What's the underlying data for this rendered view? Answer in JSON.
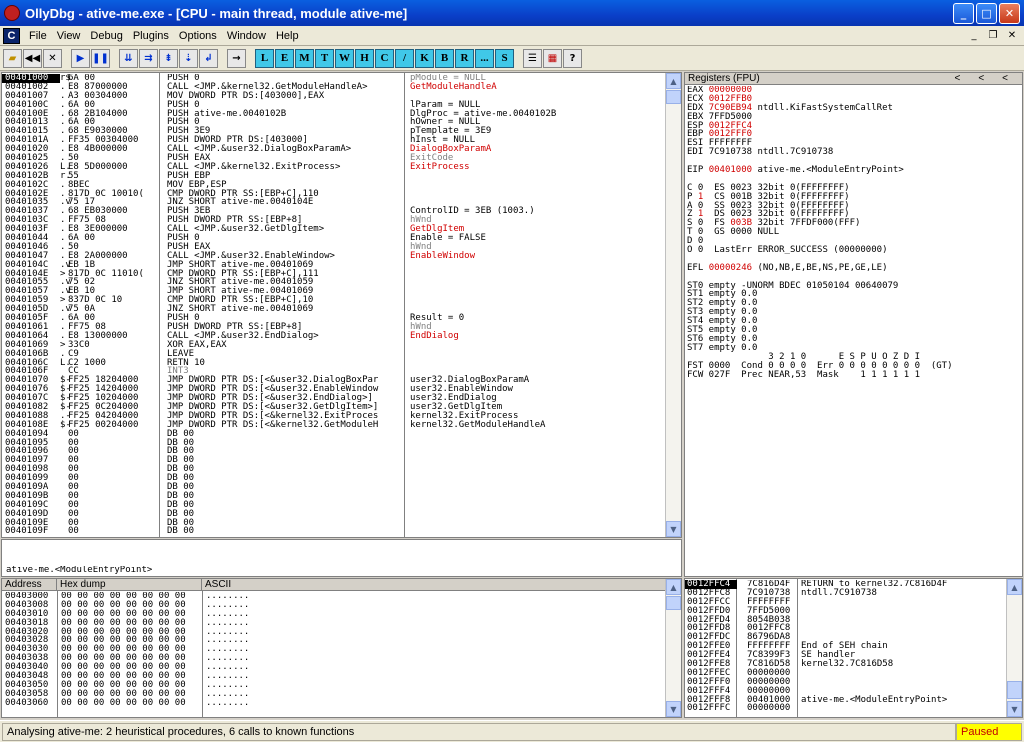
{
  "window": {
    "title": "OllyDbg - ative-me.exe - [CPU - main thread, module ative-me]"
  },
  "menu": {
    "child_icon": "C",
    "items": [
      "File",
      "View",
      "Debug",
      "Plugins",
      "Options",
      "Window",
      "Help"
    ]
  },
  "toolbar": {
    "letters": [
      "L",
      "E",
      "M",
      "T",
      "W",
      "H",
      "C",
      "/",
      "K",
      "B",
      "R",
      "...",
      "S"
    ]
  },
  "disasm": {
    "rows": [
      {
        "a": "00401000",
        "m": "r$",
        "h": "6A 00",
        "d": "PUSH 0",
        "c": "pModule = NULL",
        "cc": "gray"
      },
      {
        "a": "00401002",
        "m": ".",
        "h": "E8 87000000",
        "d": "CALL <JMP.&kernel32.GetModuleHandleA>",
        "c": "GetModuleHandleA",
        "cc": "red"
      },
      {
        "a": "00401007",
        "m": ".",
        "h": "A3 00304000",
        "d": "MOV DWORD PTR DS:[403000],EAX",
        "c": "",
        "cc": ""
      },
      {
        "a": "0040100C",
        "m": ".",
        "h": "6A 00",
        "d": "PUSH 0",
        "c": "lParam = NULL",
        "cc": ""
      },
      {
        "a": "0040100E",
        "m": ".",
        "h": "68 2B104000",
        "d": "PUSH ative-me.0040102B",
        "c": "DlgProc = ative-me.0040102B",
        "cc": ""
      },
      {
        "a": "00401013",
        "m": ".",
        "h": "6A 00",
        "d": "PUSH 0",
        "c": "hOwner = NULL",
        "cc": ""
      },
      {
        "a": "00401015",
        "m": ".",
        "h": "68 E9030000",
        "d": "PUSH 3E9",
        "c": "pTemplate = 3E9",
        "cc": ""
      },
      {
        "a": "0040101A",
        "m": ".",
        "h": "FF35 00304000",
        "d": "PUSH DWORD PTR DS:[403000]",
        "c": "hInst = NULL",
        "cc": ""
      },
      {
        "a": "00401020",
        "m": ".",
        "h": "E8 4B000000",
        "d": "CALL <JMP.&user32.DialogBoxParamA>",
        "c": "DialogBoxParamA",
        "cc": "red"
      },
      {
        "a": "00401025",
        "m": ".",
        "h": "50",
        "d": "PUSH EAX",
        "c": "ExitCode",
        "cc": "gray"
      },
      {
        "a": "00401026",
        "m": "L.",
        "h": "E8 5D000000",
        "d": "CALL <JMP.&kernel32.ExitProcess>",
        "c": "ExitProcess",
        "cc": "red"
      },
      {
        "a": "0040102B",
        "m": "r.",
        "h": "55",
        "d": "PUSH EBP",
        "c": "",
        "cc": ""
      },
      {
        "a": "0040102C",
        "m": ".",
        "h": "8BEC",
        "d": "MOV EBP,ESP",
        "c": "",
        "cc": ""
      },
      {
        "a": "0040102E",
        "m": ".",
        "h": "817D 0C 10010(",
        "d": "CMP DWORD PTR SS:[EBP+C],110",
        "c": "",
        "cc": ""
      },
      {
        "a": "00401035",
        "m": ".v",
        "h": "75 17",
        "d": "JNZ SHORT ative-me.0040104E",
        "c": "",
        "cc": ""
      },
      {
        "a": "00401037",
        "m": ".",
        "h": "68 EB030000",
        "d": "PUSH 3EB",
        "c": "ControlID = 3EB (1003.)",
        "cc": ""
      },
      {
        "a": "0040103C",
        "m": ".",
        "h": "FF75 08",
        "d": "PUSH DWORD PTR SS:[EBP+8]",
        "c": "hWnd",
        "cc": "gray"
      },
      {
        "a": "0040103F",
        "m": ".",
        "h": "E8 3E000000",
        "d": "CALL <JMP.&user32.GetDlgItem>",
        "c": "GetDlgItem",
        "cc": "red"
      },
      {
        "a": "00401044",
        "m": ".",
        "h": "6A 00",
        "d": "PUSH 0",
        "c": "Enable = FALSE",
        "cc": ""
      },
      {
        "a": "00401046",
        "m": ".",
        "h": "50",
        "d": "PUSH EAX",
        "c": "hWnd",
        "cc": "gray"
      },
      {
        "a": "00401047",
        "m": ".",
        "h": "E8 2A000000",
        "d": "CALL <JMP.&user32.EnableWindow>",
        "c": "EnableWindow",
        "cc": "red"
      },
      {
        "a": "0040104C",
        "m": ".v",
        "h": "EB 1B",
        "d": "JMP SHORT ative-me.00401069",
        "c": "",
        "cc": ""
      },
      {
        "a": "0040104E",
        "m": ">",
        "h": "817D 0C 11010(",
        "d": "CMP DWORD PTR SS:[EBP+C],111",
        "c": "",
        "cc": ""
      },
      {
        "a": "00401055",
        "m": ".v",
        "h": "75 02",
        "d": "JNZ SHORT ative-me.00401059",
        "c": "",
        "cc": ""
      },
      {
        "a": "00401057",
        "m": ".v",
        "h": "EB 10",
        "d": "JMP SHORT ative-me.00401069",
        "c": "",
        "cc": ""
      },
      {
        "a": "00401059",
        "m": ">",
        "h": "837D 0C 10",
        "d": "CMP DWORD PTR SS:[EBP+C],10",
        "c": "",
        "cc": ""
      },
      {
        "a": "0040105D",
        "m": ".v",
        "h": "75 0A",
        "d": "JNZ SHORT ative-me.00401069",
        "c": "",
        "cc": ""
      },
      {
        "a": "0040105F",
        "m": ".",
        "h": "6A 00",
        "d": "PUSH 0",
        "c": "Result = 0",
        "cc": ""
      },
      {
        "a": "00401061",
        "m": ".",
        "h": "FF75 08",
        "d": "PUSH DWORD PTR SS:[EBP+8]",
        "c": "hWnd",
        "cc": "gray"
      },
      {
        "a": "00401064",
        "m": ".",
        "h": "E8 13000000",
        "d": "CALL <JMP.&user32.EndDialog>",
        "c": "EndDialog",
        "cc": "red"
      },
      {
        "a": "00401069",
        "m": ">",
        "h": "33C0",
        "d": "XOR EAX,EAX",
        "c": "",
        "cc": ""
      },
      {
        "a": "0040106B",
        "m": ".",
        "h": "C9",
        "d": "LEAVE",
        "c": "",
        "cc": ""
      },
      {
        "a": "0040106C",
        "m": "L.",
        "h": "C2 1000",
        "d": "RETN 10",
        "c": "",
        "cc": ""
      },
      {
        "a": "0040106F",
        "m": "",
        "h": "CC",
        "d": "INT3",
        "c": "",
        "cc": ""
      },
      {
        "a": "00401070",
        "m": "$-",
        "h": "FF25 18204000",
        "d": "JMP DWORD PTR DS:[<&user32.DialogBoxPar",
        "c": "user32.DialogBoxParamA",
        "cc": ""
      },
      {
        "a": "00401076",
        "m": "$-",
        "h": "FF25 14204000",
        "d": "JMP DWORD PTR DS:[<&user32.EnableWindow",
        "c": "user32.EnableWindow",
        "cc": ""
      },
      {
        "a": "0040107C",
        "m": "$-",
        "h": "FF25 10204000",
        "d": "JMP DWORD PTR DS:[<&user32.EndDialog>]",
        "c": "user32.EndDialog",
        "cc": ""
      },
      {
        "a": "00401082",
        "m": "$-",
        "h": "FF25 0C204000",
        "d": "JMP DWORD PTR DS:[<&user32.GetDlgItem>]",
        "c": "user32.GetDlgItem",
        "cc": ""
      },
      {
        "a": "00401088",
        "m": ".-",
        "h": "FF25 04204000",
        "d": "JMP DWORD PTR DS:[<&kernel32.ExitProces",
        "c": "kernel32.ExitProcess",
        "cc": ""
      },
      {
        "a": "0040108E",
        "m": "$-",
        "h": "FF25 00204000",
        "d": "JMP DWORD PTR DS:[<&kernel32.GetModuleH",
        "c": "kernel32.GetModuleHandleA",
        "cc": ""
      },
      {
        "a": "00401094",
        "m": "",
        "h": "00",
        "d": "DB 00",
        "c": "",
        "cc": ""
      },
      {
        "a": "00401095",
        "m": "",
        "h": "00",
        "d": "DB 00",
        "c": "",
        "cc": ""
      },
      {
        "a": "00401096",
        "m": "",
        "h": "00",
        "d": "DB 00",
        "c": "",
        "cc": ""
      },
      {
        "a": "00401097",
        "m": "",
        "h": "00",
        "d": "DB 00",
        "c": "",
        "cc": ""
      },
      {
        "a": "00401098",
        "m": "",
        "h": "00",
        "d": "DB 00",
        "c": "",
        "cc": ""
      },
      {
        "a": "00401099",
        "m": "",
        "h": "00",
        "d": "DB 00",
        "c": "",
        "cc": ""
      },
      {
        "a": "0040109A",
        "m": "",
        "h": "00",
        "d": "DB 00",
        "c": "",
        "cc": ""
      },
      {
        "a": "0040109B",
        "m": "",
        "h": "00",
        "d": "DB 00",
        "c": "",
        "cc": ""
      },
      {
        "a": "0040109C",
        "m": "",
        "h": "00",
        "d": "DB 00",
        "c": "",
        "cc": ""
      },
      {
        "a": "0040109D",
        "m": "",
        "h": "00",
        "d": "DB 00",
        "c": "",
        "cc": ""
      },
      {
        "a": "0040109E",
        "m": "",
        "h": "00",
        "d": "DB 00",
        "c": "",
        "cc": ""
      },
      {
        "a": "0040109F",
        "m": "",
        "h": "00",
        "d": "DB 00",
        "c": "",
        "cc": ""
      }
    ]
  },
  "info": {
    "text": "ative-me.<ModuleEntryPoint>"
  },
  "registers": {
    "title": "Registers (FPU)",
    "lines": [
      {
        "t": "EAX ",
        "v": "00000000",
        "r": "",
        "vc": "red"
      },
      {
        "t": "ECX ",
        "v": "0012FFB0",
        "r": "",
        "vc": "red"
      },
      {
        "t": "EDX ",
        "v": "7C90EB94",
        "r": " ntdll.KiFastSystemCallRet",
        "vc": "red"
      },
      {
        "t": "EBX ",
        "v": "7FFD5000",
        "r": "",
        "vc": ""
      },
      {
        "t": "ESP ",
        "v": "0012FFC4",
        "r": "",
        "vc": "red"
      },
      {
        "t": "EBP ",
        "v": "0012FFF0",
        "r": "",
        "vc": "red"
      },
      {
        "t": "ESI ",
        "v": "FFFFFFFF",
        "r": "",
        "vc": ""
      },
      {
        "t": "EDI ",
        "v": "7C910738",
        "r": " ntdll.7C910738",
        "vc": ""
      },
      {
        "t": "",
        "v": "",
        "r": "",
        "vc": ""
      },
      {
        "t": "EIP ",
        "v": "00401000",
        "r": " ative-me.<ModuleEntryPoint>",
        "vc": "red"
      },
      {
        "t": "",
        "v": "",
        "r": "",
        "vc": ""
      },
      {
        "t": "C 0  ES 0023 32bit 0(FFFFFFFF)",
        "v": "",
        "r": "",
        "vc": ""
      },
      {
        "t": "P ",
        "v": "1",
        "r": "  CS 001B 32bit 0(FFFFFFFF)",
        "vc": "red"
      },
      {
        "t": "A 0  SS 0023 32bit 0(FFFFFFFF)",
        "v": "",
        "r": "",
        "vc": ""
      },
      {
        "t": "Z ",
        "v": "1",
        "r": "  DS 0023 32bit 0(FFFFFFFF)",
        "vc": "red"
      },
      {
        "t": "S 0  FS ",
        "v": "003B",
        "r": " 32bit 7FFDF000(FFF)",
        "vc": "red"
      },
      {
        "t": "T 0  GS 0000 NULL",
        "v": "",
        "r": "",
        "vc": ""
      },
      {
        "t": "D 0",
        "v": "",
        "r": "",
        "vc": ""
      },
      {
        "t": "O 0  LastErr ERROR_SUCCESS (00000000)",
        "v": "",
        "r": "",
        "vc": ""
      },
      {
        "t": "",
        "v": "",
        "r": "",
        "vc": ""
      },
      {
        "t": "EFL ",
        "v": "00000246",
        "r": " (NO,NB,E,BE,NS,PE,GE,LE)",
        "vc": "red"
      },
      {
        "t": "",
        "v": "",
        "r": "",
        "vc": ""
      },
      {
        "t": "ST0 empty -UNORM BDEC 01050104 00640079",
        "v": "",
        "r": "",
        "vc": ""
      },
      {
        "t": "ST1 empty 0.0",
        "v": "",
        "r": "",
        "vc": ""
      },
      {
        "t": "ST2 empty 0.0",
        "v": "",
        "r": "",
        "vc": ""
      },
      {
        "t": "ST3 empty 0.0",
        "v": "",
        "r": "",
        "vc": ""
      },
      {
        "t": "ST4 empty 0.0",
        "v": "",
        "r": "",
        "vc": ""
      },
      {
        "t": "ST5 empty 0.0",
        "v": "",
        "r": "",
        "vc": ""
      },
      {
        "t": "ST6 empty 0.0",
        "v": "",
        "r": "",
        "vc": ""
      },
      {
        "t": "ST7 empty 0.0",
        "v": "",
        "r": "",
        "vc": ""
      },
      {
        "t": "               3 2 1 0      E S P U O Z D I",
        "v": "",
        "r": "",
        "vc": ""
      },
      {
        "t": "FST 0000  Cond 0 0 0 0  Err 0 0 0 0 0 0 0 0  (GT)",
        "v": "",
        "r": "",
        "vc": ""
      },
      {
        "t": "FCW 027F  Prec NEAR,53  Mask    1 1 1 1 1 1",
        "v": "",
        "r": "",
        "vc": ""
      }
    ]
  },
  "dump": {
    "headers": [
      "Address",
      "Hex dump",
      "ASCII"
    ],
    "rows": [
      {
        "a": "00403000",
        "h": "00 00 00 00 00 00 00 00",
        "s": "........"
      },
      {
        "a": "00403008",
        "h": "00 00 00 00 00 00 00 00",
        "s": "........"
      },
      {
        "a": "00403010",
        "h": "00 00 00 00 00 00 00 00",
        "s": "........"
      },
      {
        "a": "00403018",
        "h": "00 00 00 00 00 00 00 00",
        "s": "........"
      },
      {
        "a": "00403020",
        "h": "00 00 00 00 00 00 00 00",
        "s": "........"
      },
      {
        "a": "00403028",
        "h": "00 00 00 00 00 00 00 00",
        "s": "........"
      },
      {
        "a": "00403030",
        "h": "00 00 00 00 00 00 00 00",
        "s": "........"
      },
      {
        "a": "00403038",
        "h": "00 00 00 00 00 00 00 00",
        "s": "........"
      },
      {
        "a": "00403040",
        "h": "00 00 00 00 00 00 00 00",
        "s": "........"
      },
      {
        "a": "00403048",
        "h": "00 00 00 00 00 00 00 00",
        "s": "........"
      },
      {
        "a": "00403050",
        "h": "00 00 00 00 00 00 00 00",
        "s": "........"
      },
      {
        "a": "00403058",
        "h": "00 00 00 00 00 00 00 00",
        "s": "........"
      },
      {
        "a": "00403060",
        "h": "00 00 00 00 00 00 00 00",
        "s": "........"
      }
    ]
  },
  "stack": {
    "rows": [
      {
        "a": "0012FFC4",
        "v": "7C816D4F",
        "c": "RETURN to kernel32.7C816D4F",
        "sel": true
      },
      {
        "a": "0012FFC8",
        "v": "7C910738",
        "c": "ntdll.7C910738",
        "sel": false
      },
      {
        "a": "0012FFCC",
        "v": "FFFFFFFF",
        "c": "",
        "sel": false
      },
      {
        "a": "0012FFD0",
        "v": "7FFD5000",
        "c": "",
        "sel": false
      },
      {
        "a": "0012FFD4",
        "v": "8054B038",
        "c": "",
        "sel": false
      },
      {
        "a": "0012FFD8",
        "v": "0012FFC8",
        "c": "",
        "sel": false
      },
      {
        "a": "0012FFDC",
        "v": "86796DA8",
        "c": "",
        "sel": false
      },
      {
        "a": "0012FFE0",
        "v": "FFFFFFFF",
        "c": "End of SEH chain",
        "sel": false
      },
      {
        "a": "0012FFE4",
        "v": "7C8399F3",
        "c": "SE handler",
        "sel": false
      },
      {
        "a": "0012FFE8",
        "v": "7C816D58",
        "c": "kernel32.7C816D58",
        "sel": false
      },
      {
        "a": "0012FFEC",
        "v": "00000000",
        "c": "",
        "sel": false
      },
      {
        "a": "0012FFF0",
        "v": "00000000",
        "c": "",
        "sel": false
      },
      {
        "a": "0012FFF4",
        "v": "00000000",
        "c": "",
        "sel": false
      },
      {
        "a": "0012FFF8",
        "v": "00401000",
        "c": "ative-me.<ModuleEntryPoint>",
        "sel": false
      },
      {
        "a": "0012FFFC",
        "v": "00000000",
        "c": "",
        "sel": false
      }
    ]
  },
  "status": {
    "message": "Analysing ative-me: 2 heuristical procedures, 6 calls to known functions",
    "state": "Paused"
  }
}
